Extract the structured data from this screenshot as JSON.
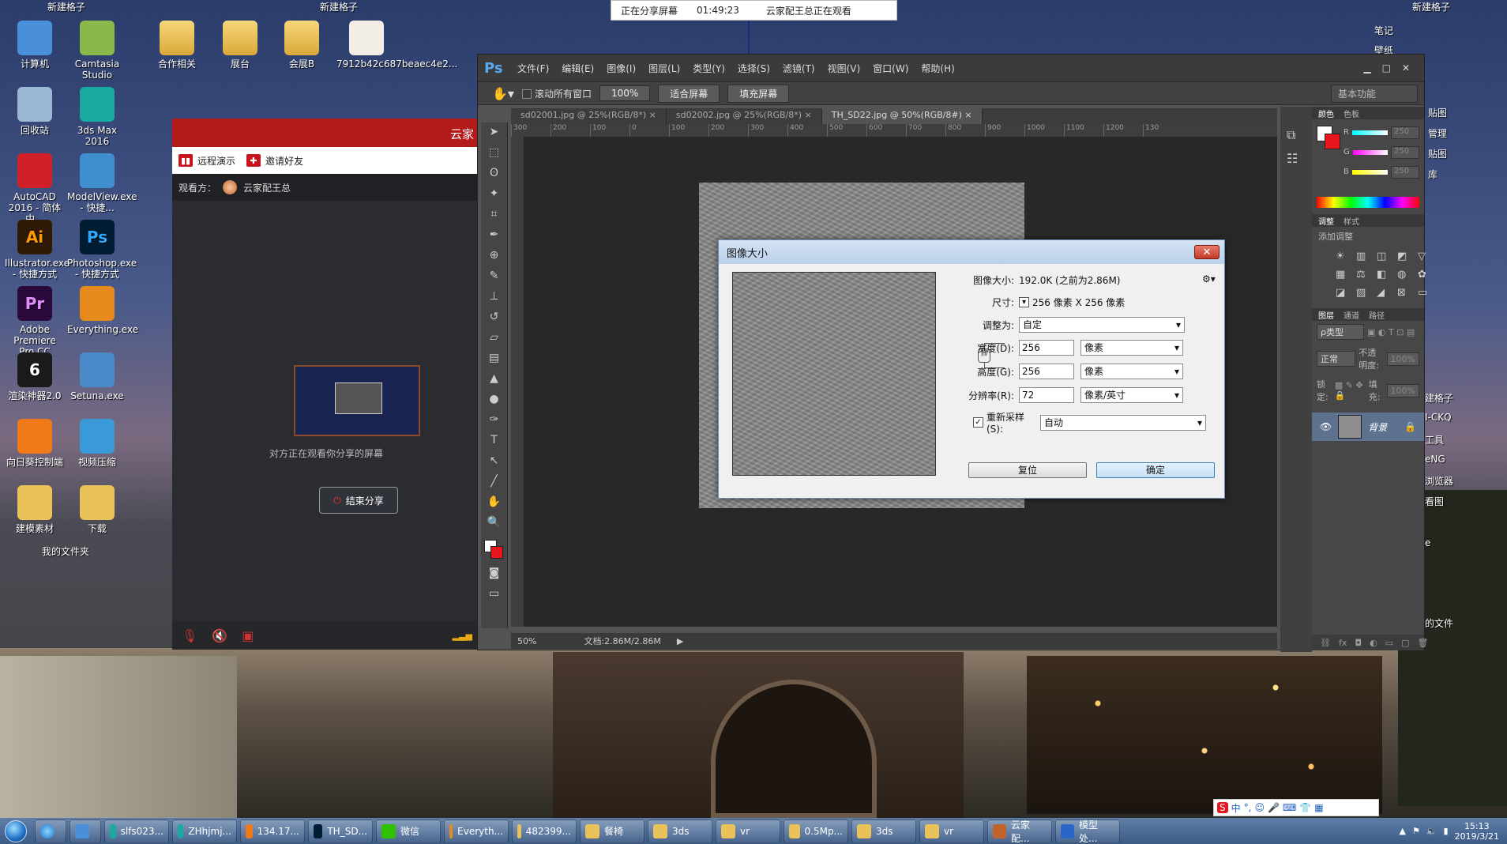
{
  "desktop": {
    "group_labels": [
      "新建格子",
      "新建格子",
      "新建格子",
      "我的文件夹"
    ],
    "icons_col1": [
      {
        "label": "计算机",
        "icon": "computer-icon",
        "color": "#4a90d9"
      },
      {
        "label": "回收站",
        "icon": "recycle-bin-icon",
        "color": "#9ab7d4"
      },
      {
        "label": "AutoCAD 2016 - 简体中...",
        "icon": "autocad-icon",
        "color": "#d0202a"
      },
      {
        "label": "Illustrator.exe - 快捷方式",
        "icon": "illustrator-icon",
        "color": "#2f1a06",
        "glyph": "Ai"
      },
      {
        "label": "Adobe Premiere Pro CC",
        "icon": "premiere-icon",
        "color": "#2a0a3a",
        "glyph": "Pr"
      },
      {
        "label": "渲染神器2.0",
        "icon": "render-tool-icon",
        "color": "#1a1a1a",
        "glyph": "6"
      },
      {
        "label": "向日葵控制端",
        "icon": "sunflower-icon",
        "color": "#f07a1a"
      },
      {
        "label": "建模素材",
        "icon": "folder-icon",
        "color": "#e9c35a"
      }
    ],
    "icons_col2": [
      {
        "label": "Camtasia Studio",
        "icon": "camtasia-icon",
        "color": "#8bb84a"
      },
      {
        "label": "3ds Max 2016",
        "icon": "3dsmax-icon",
        "color": "#1aa9a0"
      },
      {
        "label": "ModelView.exe - 快捷...",
        "icon": "modelview-icon",
        "color": "#3f8fd0"
      },
      {
        "label": "Photoshop.exe - 快捷方式",
        "icon": "photoshop-icon",
        "color": "#001d34",
        "glyph": "Ps"
      },
      {
        "label": "Everything.exe",
        "icon": "everything-icon",
        "color": "#e68a1e"
      },
      {
        "label": "Setuna.exe",
        "icon": "setuna-icon",
        "color": "#4a8ac8"
      },
      {
        "label": "视频压缩",
        "icon": "video-compress-icon",
        "color": "#3a9ad8"
      },
      {
        "label": "下载",
        "icon": "folder-download-icon",
        "color": "#e9c35a"
      }
    ],
    "icons_row_top": [
      {
        "label": "合作相关",
        "icon": "folder-icon"
      },
      {
        "label": "展台",
        "icon": "folder-icon"
      },
      {
        "label": "会展B",
        "icon": "folder-icon"
      },
      {
        "label": "7912b42c687beaec4e2...",
        "icon": "image-file-icon"
      }
    ],
    "right_labels": [
      "笔记",
      "壁纸",
      "贴图",
      "管理",
      "贴图",
      "库",
      "建格子",
      "I-CKQ",
      "工具",
      "eNG",
      "浏览器",
      "看图",
      "e",
      "的文件"
    ]
  },
  "share_banner": {
    "status": "正在分享屏幕",
    "timer": "01:49:23",
    "viewer_text": "云家配王总正在观看"
  },
  "remote": {
    "header": "云家",
    "tab_demo": "远程演示",
    "tab_invite": "邀请好友",
    "watcher_label": "观看方：",
    "watcher_name": "云家配王总",
    "caption": "对方正在观看你分享的屏幕",
    "end_button": "结束分享"
  },
  "ps": {
    "logo": "Ps",
    "menu": [
      "文件(F)",
      "编辑(E)",
      "图像(I)",
      "图层(L)",
      "类型(Y)",
      "选择(S)",
      "滤镜(T)",
      "视图(V)",
      "窗口(W)",
      "帮助(H)"
    ],
    "options": {
      "scroll_all": "滚动所有窗口",
      "zoom_100": "100%",
      "fit_screen": "适合屏幕",
      "fill_screen": "填充屏幕",
      "workspace": "基本功能"
    },
    "tabs": [
      "sd02001.jpg @ 25%(RGB/8*)",
      "sd02002.jpg @ 25%(RGB/8*)",
      "TH_SD22.jpg @ 50%(RGB/8#)"
    ],
    "ruler_ticks": [
      "300",
      "200",
      "100",
      "0",
      "100",
      "200",
      "300",
      "400",
      "500",
      "600",
      "700",
      "800",
      "900",
      "1000",
      "1100",
      "1200",
      "130"
    ],
    "status_zoom": "50%",
    "status_doc": "文档:2.86M/2.86M",
    "panels": {
      "color_tabs": [
        "颜色",
        "色板"
      ],
      "rgb": [
        {
          "label": "R",
          "value": "250"
        },
        {
          "label": "G",
          "value": "250"
        },
        {
          "label": "B",
          "value": "250"
        }
      ],
      "adjust_tabs": [
        "调整",
        "样式"
      ],
      "add_adjust": "添加调整",
      "layer_tabs": [
        "图层",
        "通道",
        "路径"
      ],
      "kind": "ρ类型",
      "blend": "正常",
      "opacity_label": "不透明度:",
      "opacity": "100%",
      "lock_label": "锁定:",
      "fill_label": "填充:",
      "fill": "100%",
      "layer_name": "背景"
    }
  },
  "dialog": {
    "title": "图像大小",
    "size_label": "图像大小:",
    "size_value": "192.0K (之前为2.86M)",
    "dims_label": "尺寸:",
    "dims_value": "256 像素  X  256 像素",
    "fit_label": "调整为:",
    "fit_value": "自定",
    "width_label": "宽度(D):",
    "width_value": "256",
    "width_unit": "像素",
    "height_label": "高度(G):",
    "height_value": "256",
    "height_unit": "像素",
    "res_label": "分辨率(R):",
    "res_value": "72",
    "res_unit": "像素/英寸",
    "resample_label": "重新采样(S):",
    "resample_value": "自动",
    "reset_button": "复位",
    "ok_button": "确定"
  },
  "taskbar": {
    "items": [
      {
        "label": "slfs023...",
        "color": "#1aa9a0"
      },
      {
        "label": "ZHhjmj...",
        "color": "#1aa9a0"
      },
      {
        "label": "134.17...",
        "color": "#f07a1a"
      },
      {
        "label": "TH_SD...",
        "color": "#001d34"
      },
      {
        "label": "微信",
        "color": "#2dc100"
      },
      {
        "label": "Everyth...",
        "color": "#e68a1e"
      },
      {
        "label": "482399...",
        "color": "#e9c35a"
      },
      {
        "label": "餐椅",
        "color": "#e9c35a"
      },
      {
        "label": "3ds",
        "color": "#e9c35a"
      },
      {
        "label": "vr",
        "color": "#e9c35a"
      },
      {
        "label": "0.5Mp...",
        "color": "#e9c35a"
      },
      {
        "label": "3ds",
        "color": "#e9c35a"
      },
      {
        "label": "vr",
        "color": "#e9c35a"
      },
      {
        "label": "云家配...",
        "color": "#c2632b"
      },
      {
        "label": "模型处...",
        "color": "#2a66c8"
      }
    ],
    "time": "15:13",
    "date": "2019/3/21",
    "ime": "中"
  }
}
